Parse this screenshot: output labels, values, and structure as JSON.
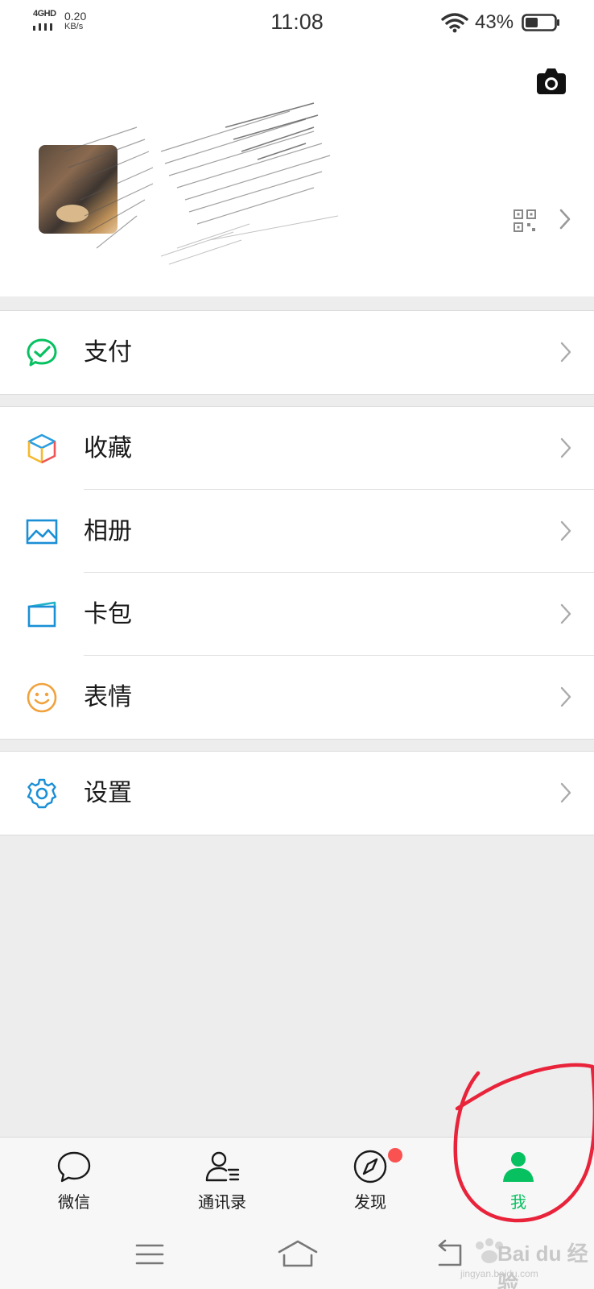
{
  "status_bar": {
    "network": "4GHD",
    "speed_value": "0.20",
    "speed_unit": "KB/s",
    "time": "11:08",
    "battery": "43%"
  },
  "menu": {
    "pay": "支付",
    "favorites": "收藏",
    "album": "相册",
    "cards": "卡包",
    "stickers": "表情",
    "settings": "设置"
  },
  "tabs": [
    {
      "label": "微信"
    },
    {
      "label": "通讯录"
    },
    {
      "label": "发现"
    },
    {
      "label": "我"
    }
  ],
  "watermark": {
    "text": "Bai du 经验",
    "sub": "jingyan.baidu.com"
  },
  "colors": {
    "accent": "#07c160",
    "badge": "#fa5151",
    "annotation": "#e8233a"
  }
}
